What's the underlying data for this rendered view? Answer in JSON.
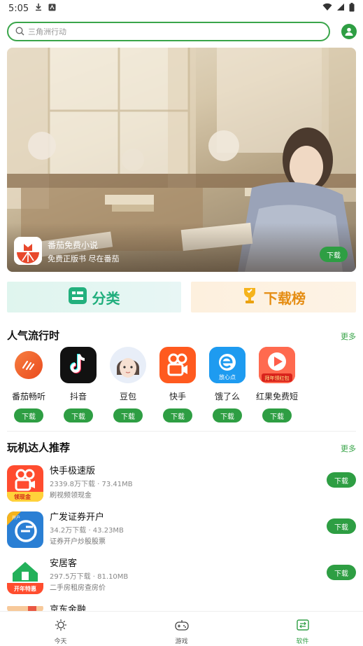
{
  "status_bar": {
    "time": "5:05"
  },
  "search": {
    "placeholder": "三角洲行动"
  },
  "banner": {
    "app_name": "番茄免费小说",
    "tagline": "免费正版书 尽在番茄",
    "download_label": "下载"
  },
  "categories": {
    "left_label": "分类",
    "right_label": "下载榜"
  },
  "popular": {
    "title": "人气流行时",
    "more": "更多",
    "items": [
      {
        "name": "番茄畅听",
        "download": "下载"
      },
      {
        "name": "抖音",
        "download": "下载"
      },
      {
        "name": "豆包",
        "download": "下载"
      },
      {
        "name": "快手",
        "download": "下载"
      },
      {
        "name": "饿了么",
        "download": "下载",
        "icon_text": "放心点"
      },
      {
        "name": "红果免费短",
        "download": "下载",
        "icon_text": "拜年领红包"
      }
    ]
  },
  "recommend": {
    "title": "玩机达人推荐",
    "more": "更多",
    "items": [
      {
        "name": "快手极速版",
        "meta": "2339.8万下载 · 73.41MB",
        "desc": "刷视频领现金",
        "download": "下载",
        "icon_text": "领现金"
      },
      {
        "name": "广发证券开户",
        "meta": "34.2万下载 · 43.23MB",
        "desc": "证券开户炒股股票",
        "download": "下载",
        "icon_text": "开户"
      },
      {
        "name": "安居客",
        "meta": "297.5万下载 · 81.10MB",
        "desc": "二手房租房查房价",
        "download": "下载",
        "icon_text": "开年特惠"
      },
      {
        "name": "京东金融"
      }
    ]
  },
  "bottom_nav": {
    "items": [
      {
        "label": "今天"
      },
      {
        "label": "游戏"
      },
      {
        "label": "软件"
      }
    ],
    "active": "软件"
  },
  "colors": {
    "accent": "#2e9e43",
    "search_border": "#3aa54a"
  }
}
